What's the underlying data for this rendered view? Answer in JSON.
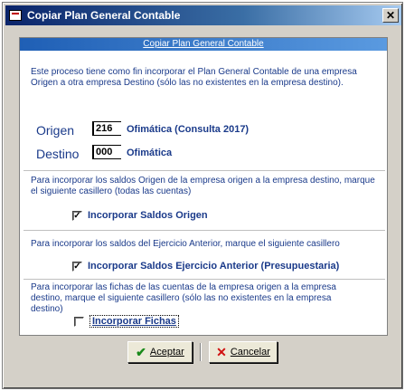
{
  "window": {
    "title": "Copiar Plan General Contable",
    "close_glyph": "✕"
  },
  "panel": {
    "header": "Copiar Plan General Contable",
    "intro": "Este proceso tiene como fin incorporar el Plan General Contable de una empresa Origen  a otra empresa Destino (sólo las no existentes en la empresa destino)."
  },
  "origen": {
    "label": "Origen",
    "code": "216",
    "company": "Ofimática (Consulta 2017)"
  },
  "destino": {
    "label": "Destino",
    "code": "000",
    "company": "Ofimática"
  },
  "saldos_origen": {
    "note": "Para incorporar los saldos Origen de la empresa origen a la empresa destino, marque el siguiente casillero (todas las cuentas)",
    "label": "Incorporar Saldos Origen",
    "checked": true,
    "mark": "✓"
  },
  "saldos_anterior": {
    "note": "Para incorporar los saldos del Ejercicio Anterior, marque el siguiente casillero",
    "label": "Incorporar Saldos Ejercicio Anterior (Presupuestaria)",
    "checked": true,
    "mark": "✓"
  },
  "fichas": {
    "note": "Para incorporar las fichas de las cuentas de la empresa origen a la empresa destino, marque el siguiente casillero (sólo las no existentes en la empresa destino)",
    "label": "Incorporar Fichas",
    "checked": false
  },
  "buttons": {
    "accept": "Aceptar",
    "cancel": "Cancelar"
  },
  "colors": {
    "label_blue": "#1a3a8a",
    "header_blue": "#1f5fb5",
    "dialog_gray": "#d4d0c8"
  }
}
